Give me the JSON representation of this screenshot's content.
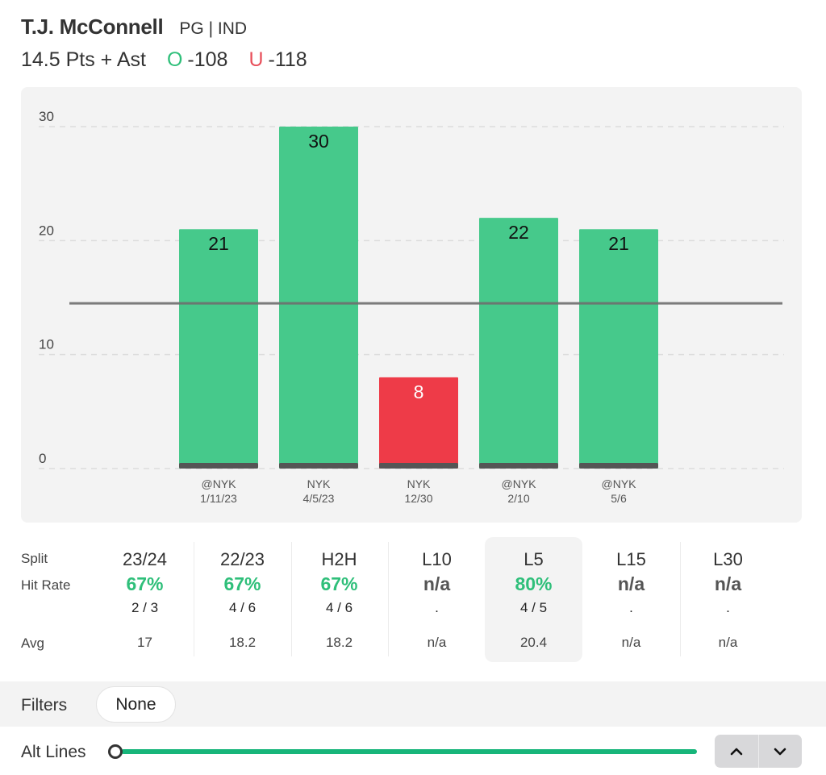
{
  "header": {
    "player_name": "T.J. McConnell",
    "player_meta": "PG | IND",
    "prop_label": "14.5 Pts + Ast",
    "over_symbol": "O",
    "over_odds": "-108",
    "under_symbol": "U",
    "under_odds": "-118"
  },
  "colors": {
    "hit": "#46c98b",
    "miss": "#ee3b48",
    "base_strip": "#555555",
    "line": "#6e6e6e",
    "accent": "#17b57a"
  },
  "chart_data": {
    "type": "bar",
    "title": "",
    "xlabel": "",
    "ylabel": "",
    "ylim": [
      0,
      30
    ],
    "yticks": [
      0,
      10,
      20,
      30
    ],
    "grid": true,
    "line_value": 14.5,
    "categories": [
      {
        "opponent": "@NYK",
        "date": "1/11/23"
      },
      {
        "opponent": "NYK",
        "date": "4/5/23"
      },
      {
        "opponent": "NYK",
        "date": "12/30"
      },
      {
        "opponent": "@NYK",
        "date": "2/10"
      },
      {
        "opponent": "@NYK",
        "date": "5/6"
      }
    ],
    "values": [
      21,
      30,
      8,
      22,
      21
    ],
    "outcomes": [
      "over",
      "over",
      "under",
      "over",
      "over"
    ]
  },
  "splits": {
    "row_labels": {
      "split": "Split",
      "hit_rate": "Hit Rate",
      "avg": "Avg"
    },
    "columns": [
      {
        "name": "23/24",
        "rate": "67%",
        "frac": "2 / 3",
        "avg": "17",
        "hit": true,
        "selected": false
      },
      {
        "name": "22/23",
        "rate": "67%",
        "frac": "4 / 6",
        "avg": "18.2",
        "hit": true,
        "selected": false
      },
      {
        "name": "H2H",
        "rate": "67%",
        "frac": "4 / 6",
        "avg": "18.2",
        "hit": true,
        "selected": false
      },
      {
        "name": "L10",
        "rate": "n/a",
        "frac": ".",
        "avg": "n/a",
        "hit": false,
        "selected": false
      },
      {
        "name": "L5",
        "rate": "80%",
        "frac": "4 / 5",
        "avg": "20.4",
        "hit": true,
        "selected": true
      },
      {
        "name": "L15",
        "rate": "n/a",
        "frac": ".",
        "avg": "n/a",
        "hit": false,
        "selected": false
      },
      {
        "name": "L30",
        "rate": "n/a",
        "frac": ".",
        "avg": "n/a",
        "hit": false,
        "selected": false
      }
    ]
  },
  "filters": {
    "label": "Filters",
    "value": "None"
  },
  "alt_lines": {
    "label": "Alt Lines",
    "slider_position": 0,
    "up_icon": "chevron-up-icon",
    "down_icon": "chevron-down-icon"
  }
}
